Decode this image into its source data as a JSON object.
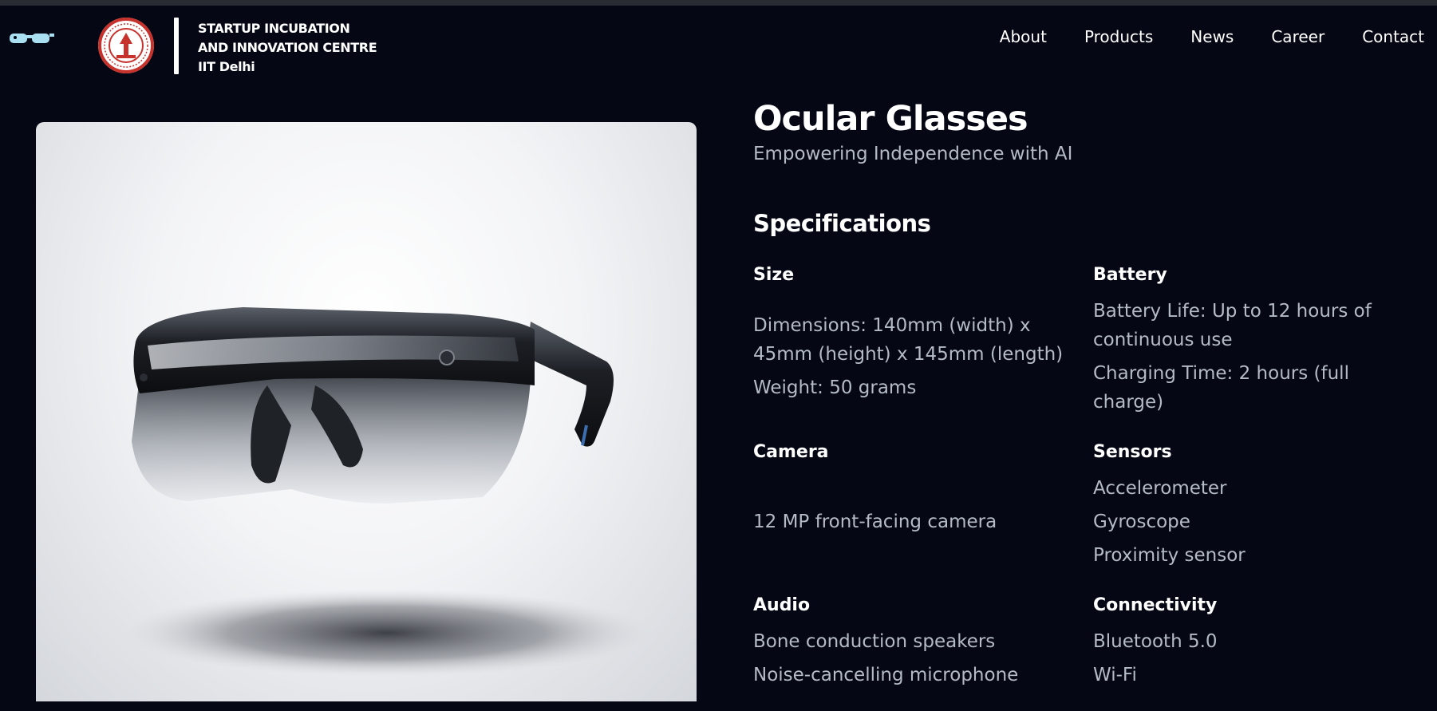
{
  "header": {
    "org_name_lines": [
      "STARTUP INCUBATION",
      "AND INNOVATION CENTRE",
      "IIT Delhi"
    ],
    "nav": [
      "About",
      "Products",
      "News",
      "Career",
      "Contact"
    ]
  },
  "product": {
    "title": "Ocular Glasses",
    "tagline": "Empowering Independence with AI"
  },
  "specifications": {
    "heading": "Specifications",
    "size": {
      "title": "Size",
      "lines": [
        "Dimensions: 140mm (width) x",
        "45mm (height) x 145mm (length)",
        "Weight: 50 grams"
      ]
    },
    "battery": {
      "title": "Battery",
      "lines": [
        "Battery Life: Up to 12 hours of",
        "continuous use",
        "Charging Time: 2 hours (full",
        "charge)"
      ]
    },
    "camera": {
      "title": "Camera",
      "lines": [
        "12 MP front-facing camera"
      ]
    },
    "sensors": {
      "title": "Sensors",
      "lines": [
        "Accelerometer",
        "Gyroscope",
        "Proximity sensor"
      ]
    },
    "audio": {
      "title": "Audio",
      "lines": [
        "Bone conduction speakers",
        "Noise-cancelling microphone"
      ]
    },
    "connectivity": {
      "title": "Connectivity",
      "lines": [
        "Bluetooth 5.0",
        "Wi-Fi"
      ]
    }
  },
  "colors": {
    "background": "#050814",
    "text_primary": "#ffffff",
    "text_secondary": "#b4bac6",
    "logo_red": "#c8322d"
  }
}
